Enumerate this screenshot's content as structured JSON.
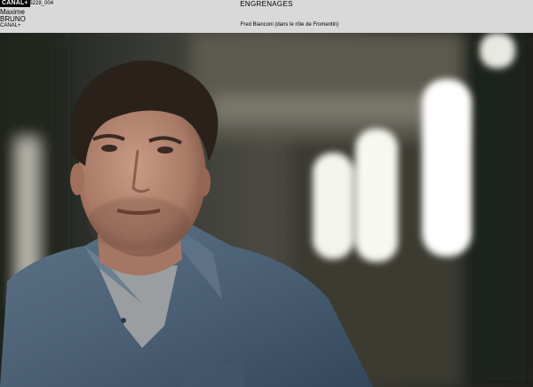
{
  "header": {
    "logo": "CANAL+",
    "ref": "05228_004",
    "first_name": "Maxime",
    "last_name": "BRUNO",
    "channel": "CANAL+",
    "title": "ENGRENAGES",
    "caption": "Fred Bianconi (dans le rôle de Fromentin)"
  },
  "photo": {
    "subject": "man-in-blue-shirt-portrait",
    "colors": {
      "shirt": "#4f6478",
      "skin": "#b98a74",
      "hair": "#2a211b",
      "tshirt": "#9a9ea0"
    }
  }
}
